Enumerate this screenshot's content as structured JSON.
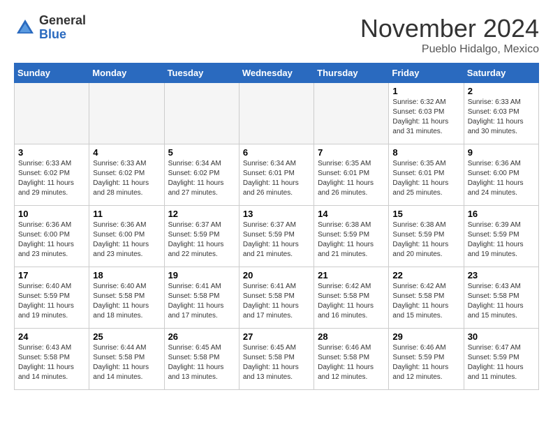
{
  "header": {
    "logo_general": "General",
    "logo_blue": "Blue",
    "month_title": "November 2024",
    "location": "Pueblo Hidalgo, Mexico"
  },
  "days_of_week": [
    "Sunday",
    "Monday",
    "Tuesday",
    "Wednesday",
    "Thursday",
    "Friday",
    "Saturday"
  ],
  "weeks": [
    [
      {
        "day": "",
        "empty": true
      },
      {
        "day": "",
        "empty": true
      },
      {
        "day": "",
        "empty": true
      },
      {
        "day": "",
        "empty": true
      },
      {
        "day": "",
        "empty": true
      },
      {
        "day": "1",
        "sunrise": "Sunrise: 6:32 AM",
        "sunset": "Sunset: 6:03 PM",
        "daylight": "Daylight: 11 hours and 31 minutes."
      },
      {
        "day": "2",
        "sunrise": "Sunrise: 6:33 AM",
        "sunset": "Sunset: 6:03 PM",
        "daylight": "Daylight: 11 hours and 30 minutes."
      }
    ],
    [
      {
        "day": "3",
        "sunrise": "Sunrise: 6:33 AM",
        "sunset": "Sunset: 6:02 PM",
        "daylight": "Daylight: 11 hours and 29 minutes."
      },
      {
        "day": "4",
        "sunrise": "Sunrise: 6:33 AM",
        "sunset": "Sunset: 6:02 PM",
        "daylight": "Daylight: 11 hours and 28 minutes."
      },
      {
        "day": "5",
        "sunrise": "Sunrise: 6:34 AM",
        "sunset": "Sunset: 6:02 PM",
        "daylight": "Daylight: 11 hours and 27 minutes."
      },
      {
        "day": "6",
        "sunrise": "Sunrise: 6:34 AM",
        "sunset": "Sunset: 6:01 PM",
        "daylight": "Daylight: 11 hours and 26 minutes."
      },
      {
        "day": "7",
        "sunrise": "Sunrise: 6:35 AM",
        "sunset": "Sunset: 6:01 PM",
        "daylight": "Daylight: 11 hours and 26 minutes."
      },
      {
        "day": "8",
        "sunrise": "Sunrise: 6:35 AM",
        "sunset": "Sunset: 6:01 PM",
        "daylight": "Daylight: 11 hours and 25 minutes."
      },
      {
        "day": "9",
        "sunrise": "Sunrise: 6:36 AM",
        "sunset": "Sunset: 6:00 PM",
        "daylight": "Daylight: 11 hours and 24 minutes."
      }
    ],
    [
      {
        "day": "10",
        "sunrise": "Sunrise: 6:36 AM",
        "sunset": "Sunset: 6:00 PM",
        "daylight": "Daylight: 11 hours and 23 minutes."
      },
      {
        "day": "11",
        "sunrise": "Sunrise: 6:36 AM",
        "sunset": "Sunset: 6:00 PM",
        "daylight": "Daylight: 11 hours and 23 minutes."
      },
      {
        "day": "12",
        "sunrise": "Sunrise: 6:37 AM",
        "sunset": "Sunset: 5:59 PM",
        "daylight": "Daylight: 11 hours and 22 minutes."
      },
      {
        "day": "13",
        "sunrise": "Sunrise: 6:37 AM",
        "sunset": "Sunset: 5:59 PM",
        "daylight": "Daylight: 11 hours and 21 minutes."
      },
      {
        "day": "14",
        "sunrise": "Sunrise: 6:38 AM",
        "sunset": "Sunset: 5:59 PM",
        "daylight": "Daylight: 11 hours and 21 minutes."
      },
      {
        "day": "15",
        "sunrise": "Sunrise: 6:38 AM",
        "sunset": "Sunset: 5:59 PM",
        "daylight": "Daylight: 11 hours and 20 minutes."
      },
      {
        "day": "16",
        "sunrise": "Sunrise: 6:39 AM",
        "sunset": "Sunset: 5:59 PM",
        "daylight": "Daylight: 11 hours and 19 minutes."
      }
    ],
    [
      {
        "day": "17",
        "sunrise": "Sunrise: 6:40 AM",
        "sunset": "Sunset: 5:59 PM",
        "daylight": "Daylight: 11 hours and 19 minutes."
      },
      {
        "day": "18",
        "sunrise": "Sunrise: 6:40 AM",
        "sunset": "Sunset: 5:58 PM",
        "daylight": "Daylight: 11 hours and 18 minutes."
      },
      {
        "day": "19",
        "sunrise": "Sunrise: 6:41 AM",
        "sunset": "Sunset: 5:58 PM",
        "daylight": "Daylight: 11 hours and 17 minutes."
      },
      {
        "day": "20",
        "sunrise": "Sunrise: 6:41 AM",
        "sunset": "Sunset: 5:58 PM",
        "daylight": "Daylight: 11 hours and 17 minutes."
      },
      {
        "day": "21",
        "sunrise": "Sunrise: 6:42 AM",
        "sunset": "Sunset: 5:58 PM",
        "daylight": "Daylight: 11 hours and 16 minutes."
      },
      {
        "day": "22",
        "sunrise": "Sunrise: 6:42 AM",
        "sunset": "Sunset: 5:58 PM",
        "daylight": "Daylight: 11 hours and 15 minutes."
      },
      {
        "day": "23",
        "sunrise": "Sunrise: 6:43 AM",
        "sunset": "Sunset: 5:58 PM",
        "daylight": "Daylight: 11 hours and 15 minutes."
      }
    ],
    [
      {
        "day": "24",
        "sunrise": "Sunrise: 6:43 AM",
        "sunset": "Sunset: 5:58 PM",
        "daylight": "Daylight: 11 hours and 14 minutes."
      },
      {
        "day": "25",
        "sunrise": "Sunrise: 6:44 AM",
        "sunset": "Sunset: 5:58 PM",
        "daylight": "Daylight: 11 hours and 14 minutes."
      },
      {
        "day": "26",
        "sunrise": "Sunrise: 6:45 AM",
        "sunset": "Sunset: 5:58 PM",
        "daylight": "Daylight: 11 hours and 13 minutes."
      },
      {
        "day": "27",
        "sunrise": "Sunrise: 6:45 AM",
        "sunset": "Sunset: 5:58 PM",
        "daylight": "Daylight: 11 hours and 13 minutes."
      },
      {
        "day": "28",
        "sunrise": "Sunrise: 6:46 AM",
        "sunset": "Sunset: 5:58 PM",
        "daylight": "Daylight: 11 hours and 12 minutes."
      },
      {
        "day": "29",
        "sunrise": "Sunrise: 6:46 AM",
        "sunset": "Sunset: 5:59 PM",
        "daylight": "Daylight: 11 hours and 12 minutes."
      },
      {
        "day": "30",
        "sunrise": "Sunrise: 6:47 AM",
        "sunset": "Sunset: 5:59 PM",
        "daylight": "Daylight: 11 hours and 11 minutes."
      }
    ]
  ]
}
